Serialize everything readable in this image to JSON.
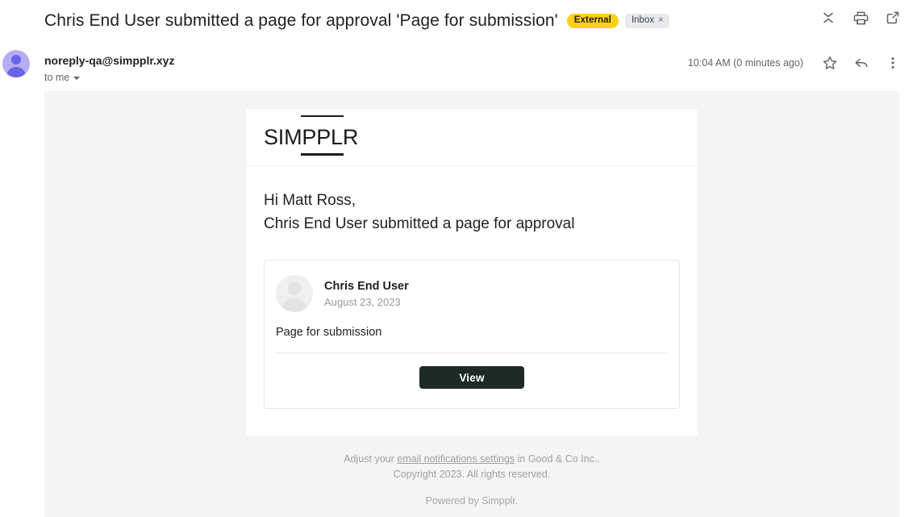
{
  "header": {
    "subject": "Chris End User submitted a page for approval 'Page for submission'",
    "badge_external": "External",
    "badge_inbox": "Inbox",
    "badge_inbox_close": "×",
    "icons": {
      "collapse": "collapse-all-icon",
      "print": "print-icon",
      "popout": "open-in-new-window-icon"
    }
  },
  "sender": {
    "email": "noreply-qa@simpplr.xyz",
    "recipients": "to me",
    "timestamp": "10:04 AM (0 minutes ago)",
    "icons": {
      "star": "star-icon",
      "reply": "reply-icon",
      "more": "more-options-icon"
    }
  },
  "email": {
    "logo": {
      "part1": "SIM",
      "part2": "PPL",
      "part3": "R"
    },
    "greeting_line1": "Hi Matt Ross,",
    "greeting_line2": "Chris End User submitted a page for approval",
    "content_card": {
      "author_name": "Chris End User",
      "author_date": "August 23, 2023",
      "item_title": "Page for submission",
      "button_label": "View"
    },
    "footer": {
      "line1_pre": "Adjust your ",
      "line1_link": "email notifications settings",
      "line1_post": " in Good & Co Inc..",
      "line2": "Copyright 2023. All rights reserved.",
      "powered_by": "Powered by Simpplr."
    }
  },
  "colors": {
    "badge_external_bg": "#fbd017",
    "badge_inbox_bg": "#e8eaed",
    "button_bg": "#1f2a26",
    "body_bg": "#f4f4f4",
    "sender_avatar": "#6c63e6"
  }
}
